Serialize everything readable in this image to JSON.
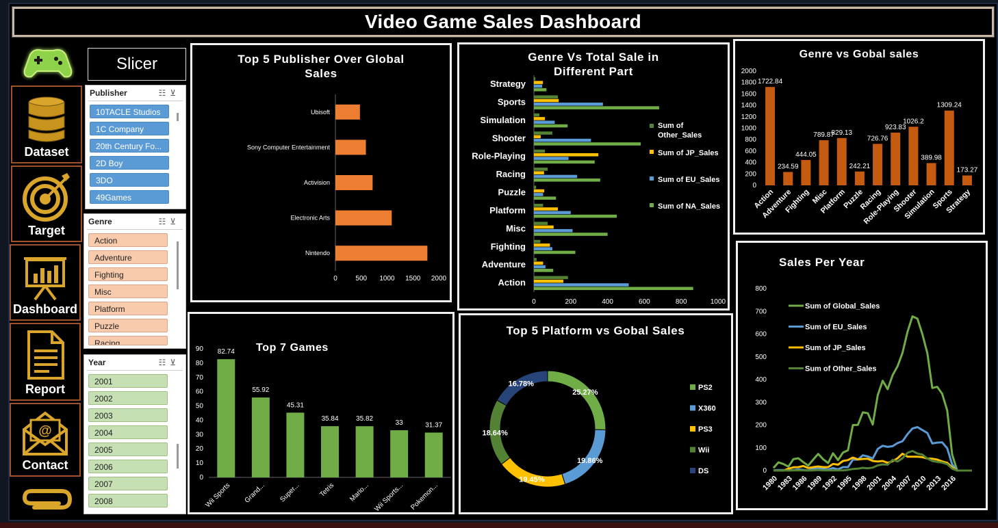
{
  "title": "Video Game Sales Dashboard",
  "slicer_label": "Slicer",
  "nav": [
    {
      "label": "Dataset",
      "icon": "database-icon"
    },
    {
      "label": "Target",
      "icon": "target-icon"
    },
    {
      "label": "Dashboard",
      "icon": "presentation-chart-icon"
    },
    {
      "label": "Report",
      "icon": "document-icon"
    },
    {
      "label": "Contact",
      "icon": "email-icon"
    }
  ],
  "slicers": {
    "publisher": {
      "header": "Publisher",
      "items": [
        "10TACLE Studios",
        "1C Company",
        "20th Century Fo...",
        "2D Boy",
        "3DO",
        "49Games"
      ]
    },
    "genre": {
      "header": "Genre",
      "items": [
        "Action",
        "Adventure",
        "Fighting",
        "Misc",
        "Platform",
        "Puzzle",
        "Racing"
      ]
    },
    "year": {
      "header": "Year",
      "items": [
        "2001",
        "2002",
        "2003",
        "2004",
        "2005",
        "2006",
        "2007",
        "2008"
      ]
    }
  },
  "colors": {
    "orange": "#ed7d31",
    "green": "#70ad47",
    "blue": "#5b9bd5",
    "gold": "#ffc000",
    "darkgreen": "#548235",
    "navy": "#264478"
  },
  "chart_data": [
    {
      "id": "publisher",
      "type": "bar",
      "title": "Top 5 Publisher Over Global Sales",
      "categories": [
        "Ubisoft",
        "Sony Computer Entertainment",
        "Activision",
        "Electronic Arts",
        "Nintendo"
      ],
      "values": [
        475,
        590,
        720,
        1090,
        1780
      ],
      "ticks": [
        "0",
        "500",
        "1000",
        "1500",
        "2000"
      ],
      "xlim": [
        0,
        2000
      ]
    },
    {
      "id": "genre_region",
      "type": "bar",
      "title": "Genre Vs Total Sale in Different Part",
      "categories": [
        "Strategy",
        "Sports",
        "Simulation",
        "Shooter",
        "Role-Playing",
        "Racing",
        "Puzzle",
        "Platform",
        "Misc",
        "Fighting",
        "Adventure",
        "Action"
      ],
      "series": [
        {
          "name": "Sum of Other_Sales",
          "values": [
            8,
            130,
            30,
            100,
            60,
            75,
            12,
            50,
            75,
            35,
            15,
            185
          ]
        },
        {
          "name": "Sum of JP_Sales",
          "values": [
            49,
            135,
            60,
            37,
            350,
            55,
            56,
            130,
            107,
            87,
            50,
            160
          ]
        },
        {
          "name": "Sum of EU_Sales",
          "values": [
            45,
            375,
            113,
            310,
            188,
            235,
            50,
            200,
            210,
            100,
            63,
            515
          ]
        },
        {
          "name": "Sum of NA_Sales",
          "values": [
            68,
            680,
            183,
            580,
            330,
            360,
            120,
            450,
            400,
            225,
            105,
            865
          ]
        }
      ],
      "ticks": [
        "0",
        "200",
        "400",
        "600",
        "800",
        "1000"
      ],
      "xlim": [
        0,
        1000
      ]
    },
    {
      "id": "genre_global",
      "type": "bar",
      "title": "Genre vs Gobal sales",
      "categories": [
        "Action",
        "Adventure",
        "Fighting",
        "Misc",
        "Platform",
        "Puzzle",
        "Racing",
        "Role-Playing",
        "Shooter",
        "Simulation",
        "Sports",
        "Strategy"
      ],
      "values": [
        1722.84,
        234.59,
        444.05,
        789.87,
        829.13,
        242.21,
        726.76,
        923.83,
        1026.2,
        389.98,
        1309.24,
        173.27
      ],
      "labels": [
        "1722.84",
        "234.59",
        "444.05",
        "789.87",
        "829.13",
        "242.21",
        "726.76",
        "923.83",
        "1026.2",
        "389.98",
        "1309.24",
        "173.27"
      ],
      "ticks": [
        "0",
        "200",
        "400",
        "600",
        "800",
        "1000",
        "1200",
        "1400",
        "1600",
        "1800",
        "2000"
      ],
      "ylim": [
        0,
        2000
      ]
    },
    {
      "id": "top_games",
      "type": "bar",
      "title": "Top 7 Games",
      "categories": [
        "Wii Sports",
        "Grand...",
        "Super...",
        "Tetris",
        "Mario...",
        "Wii Sports...",
        "Pokemon..."
      ],
      "values": [
        82.74,
        55.92,
        45.31,
        35.84,
        35.82,
        33,
        31.37
      ],
      "labels": [
        "82.74",
        "55.92",
        "45.31",
        "35.84",
        "35.82",
        "33",
        "31.37"
      ],
      "ticks": [
        "0",
        "10",
        "20",
        "30",
        "40",
        "50",
        "60",
        "70",
        "80",
        "90"
      ],
      "ylim": [
        0,
        90
      ]
    },
    {
      "id": "platform",
      "type": "pie",
      "title": "Top 5 Platform vs Gobal Sales",
      "categories": [
        "PS2",
        "X360",
        "PS3",
        "Wii",
        "DS"
      ],
      "values": [
        25.27,
        19.86,
        19.45,
        18.64,
        16.78
      ],
      "labels": [
        "25.27%",
        "19.86%",
        "19.45%",
        "18.64%",
        "16.78%"
      ]
    },
    {
      "id": "per_year",
      "type": "line",
      "title": "Sales Per Year",
      "x": [
        1980,
        1981,
        1982,
        1983,
        1984,
        1985,
        1986,
        1987,
        1988,
        1989,
        1990,
        1991,
        1992,
        1993,
        1994,
        1995,
        1996,
        1997,
        1998,
        1999,
        2000,
        2001,
        2002,
        2003,
        2004,
        2005,
        2006,
        2007,
        2008,
        2009,
        2010,
        2011,
        2012,
        2013,
        2014,
        2015,
        2016,
        2017,
        2020
      ],
      "xticks": [
        "1980",
        "1983",
        "1986",
        "1989",
        "1992",
        "1995",
        "1998",
        "2001",
        "2004",
        "2007",
        "2010",
        "2013",
        "2016"
      ],
      "series": [
        {
          "name": "Sum of Global_Sales",
          "values": [
            11,
            36,
            29,
            17,
            50,
            54,
            37,
            22,
            48,
            73,
            50,
            33,
            76,
            46,
            79,
            89,
            200,
            201,
            256,
            252,
            202,
            331,
            395,
            358,
            419,
            459,
            518,
            610,
            678,
            668,
            600,
            516,
            363,
            368,
            337,
            264,
            71,
            0,
            0
          ]
        },
        {
          "name": "Sum of EU_Sales",
          "values": [
            1,
            2,
            2,
            1,
            2,
            5,
            3,
            1,
            7,
            9,
            8,
            4,
            11,
            5,
            15,
            15,
            48,
            48,
            67,
            62,
            53,
            95,
            109,
            104,
            107,
            121,
            129,
            160,
            185,
            191,
            178,
            165,
            119,
            123,
            124,
            98,
            27,
            0,
            0
          ]
        },
        {
          "name": "Sum of JP_Sales",
          "values": [
            0,
            0,
            0,
            8,
            14,
            15,
            20,
            11,
            15,
            18,
            15,
            15,
            29,
            26,
            42,
            46,
            57,
            49,
            51,
            52,
            42,
            40,
            42,
            34,
            41,
            54,
            74,
            61,
            61,
            61,
            59,
            53,
            52,
            48,
            40,
            34,
            14,
            0,
            0
          ]
        },
        {
          "name": "Sum of Other_Sales",
          "values": [
            0,
            0,
            1,
            0,
            1,
            1,
            1,
            0,
            1,
            2,
            1,
            1,
            1,
            1,
            1,
            3,
            7,
            8,
            12,
            10,
            13,
            23,
            27,
            26,
            47,
            40,
            54,
            78,
            86,
            75,
            70,
            53,
            42,
            38,
            35,
            28,
            8,
            0,
            0
          ]
        }
      ],
      "yticks": [
        "0",
        "100",
        "200",
        "300",
        "400",
        "500",
        "600",
        "700",
        "800"
      ],
      "ylim": [
        0,
        800
      ]
    }
  ]
}
